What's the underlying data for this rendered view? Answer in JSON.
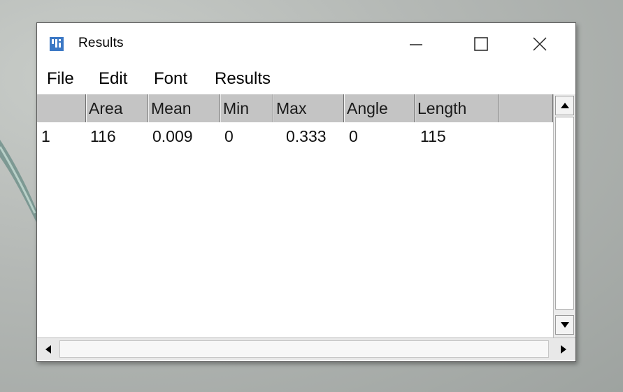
{
  "window": {
    "title": "Results",
    "icon": "imagej-icon",
    "controls": [
      "minimize-icon",
      "maximize-icon",
      "close-icon"
    ]
  },
  "menu": [
    "File",
    "Edit",
    "Font",
    "Results"
  ],
  "table": {
    "columns": [
      "",
      "Area",
      "Mean",
      "Min",
      "Max",
      "Angle",
      "Length",
      ""
    ],
    "rows": [
      [
        "1",
        "116",
        "0.009",
        "0",
        "0.333",
        "0",
        "115",
        ""
      ]
    ]
  },
  "colors": {
    "header_bg": "#c4c4c4",
    "icon_blue": "#3b78c5"
  }
}
